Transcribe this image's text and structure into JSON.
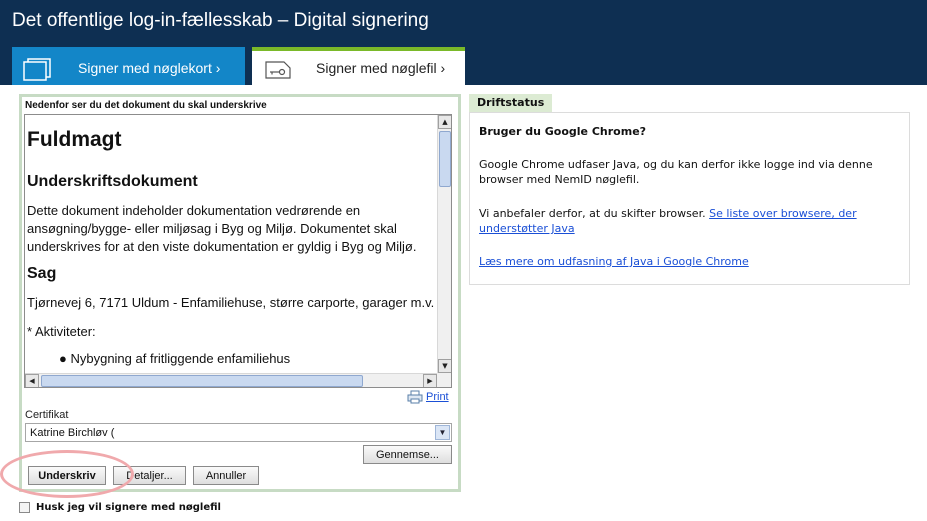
{
  "header": {
    "title": "Det offentlige log-in-fællesskab – Digital signering",
    "tabs": [
      {
        "label": "Signer med nøglekort ›",
        "icon": "card-icon",
        "active": false
      },
      {
        "label": "Signer med nøglefil ›",
        "icon": "key-file-icon",
        "active": true
      }
    ]
  },
  "signing": {
    "heading": "Nedenfor ser du det dokument du skal underskrive",
    "document": {
      "title": "Fuldmagt",
      "subtitle": "Underskriftsdokument",
      "paragraph": "Dette dokument indeholder dokumentation vedrørende en ansøgning/bygge- eller miljøsag i Byg og Miljø. Dokumentet skal underskrives for at den viste dokumentation er gyldig i Byg og Miljø.",
      "case_heading": "Sag",
      "case_text": "Tjørnevej 6, 7171 Uldum - Enfamiliehuse, større carporte, garager m.v.",
      "activities_heading": "* Aktiviteter:",
      "activity_item": "Nybygning af fritliggende enfamiliehus"
    },
    "print_label": "Print",
    "certificate_label": "Certifikat",
    "certificate_value": "Katrine Birchløv (",
    "browse_label": "Gennemse...",
    "sign_label": "Underskriv",
    "details_label": "Detaljer...",
    "cancel_label": "Annuller",
    "remember_label": "Husk jeg vil signere med nøglefil",
    "remember_checked": false
  },
  "status": {
    "tab_label": "Driftstatus",
    "heading": "Bruger du Google Chrome?",
    "paragraph1": "Google Chrome udfaser Java, og du kan derfor ikke logge ind via denne browser med NemID nøglefil.",
    "paragraph2_text": "Vi anbefaler derfor, at du skifter browser.",
    "paragraph2_link": "Se liste over browsere, der understøtter Java",
    "more_link": "Læs mere om udfasning af Java i Google Chrome"
  },
  "colors": {
    "header_bg": "#0e2f52",
    "card_tab_bg": "#1386c8",
    "file_tab_accent": "#7ab929",
    "panel_border": "#c7dbc4",
    "link": "#1a4fd6",
    "highlight_ring": "#f0a9ac"
  }
}
